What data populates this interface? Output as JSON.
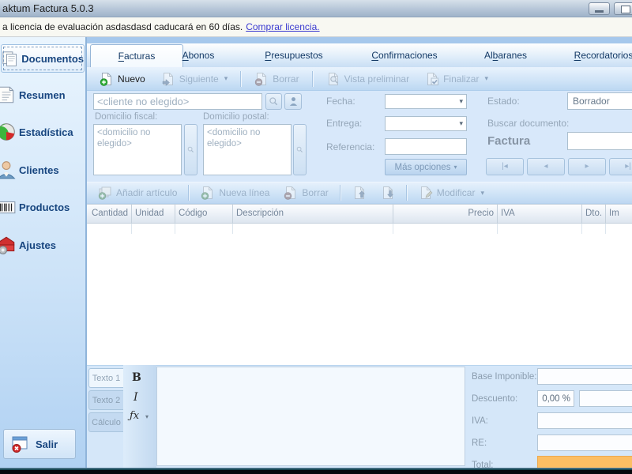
{
  "window": {
    "title": "aktum Factura 5.0.3"
  },
  "license_bar": {
    "text": "a licencia de evaluación asdasdasd caducará en 60 días.",
    "link": "Comprar licencia."
  },
  "sidebar": {
    "items": [
      {
        "label": "Documentos",
        "icon": "documents-icon",
        "active": true
      },
      {
        "label": "Resumen",
        "icon": "summary-icon",
        "active": false
      },
      {
        "label": "Estadística",
        "icon": "statistics-pie-icon",
        "active": false
      },
      {
        "label": "Clientes",
        "icon": "clients-person-icon",
        "active": false
      },
      {
        "label": "Productos",
        "icon": "products-barcode-icon",
        "active": false
      },
      {
        "label": "Ajustes",
        "icon": "settings-toolbox-icon",
        "active": false
      }
    ],
    "exit_label": "Salir"
  },
  "tabs": {
    "items": [
      {
        "label": "Facturas",
        "accel": "0",
        "active": true
      },
      {
        "label": "Abonos",
        "accel": "0",
        "active": false
      },
      {
        "label": "Presupuestos",
        "accel": "0",
        "active": false
      },
      {
        "label": "Confirmaciones",
        "accel": "0",
        "active": false
      },
      {
        "label": "Albaranes",
        "accel": "2",
        "active": false
      },
      {
        "label": "Recordatorios",
        "accel": "0",
        "active": false
      }
    ]
  },
  "doc_toolbar": {
    "new": "Nuevo",
    "next": "Siguiente",
    "delete": "Borrar",
    "preview": "Vista preliminar",
    "finalize": "Finalizar"
  },
  "form": {
    "client_placeholder": "<cliente no elegido>",
    "fiscal_address_label": "Domicilio fiscal:",
    "postal_address_label": "Domicilio postal:",
    "address_placeholder": "<domicilio no elegido>",
    "date_label": "Fecha:",
    "delivery_label": "Entrega:",
    "reference_label": "Referencia:",
    "more_options_label": "Más opciones",
    "state_label": "Estado:",
    "state_value": "Borrador",
    "search_label": "Buscar documento:",
    "doc_type_label": "Factura"
  },
  "nav": {
    "first": "|◂",
    "prev": "◂",
    "next": "▸",
    "last": "▸|"
  },
  "lines_toolbar": {
    "add_article": "Añadir artículo",
    "new_line": "Nueva línea",
    "delete": "Borrar",
    "modify": "Modificar"
  },
  "grid": {
    "columns": [
      "Cantidad",
      "Unidad",
      "Código",
      "Descripción",
      "Precio",
      "IVA",
      "Dto.",
      "Im"
    ]
  },
  "editor": {
    "tabs": [
      "Texto 1",
      "Texto 2",
      "Cálculo"
    ],
    "bold": "B",
    "italic": "I",
    "formula": "ƒx"
  },
  "totals": {
    "base_label": "Base Imponible:",
    "discount_label": "Descuento:",
    "discount_pct": "0,00 %",
    "iva_label": "IVA:",
    "re_label": "RE:",
    "total_label": "Total:"
  },
  "icons": {
    "chevron_down": "▾"
  },
  "colors": {
    "sidebar_text": "#17457f",
    "link": "#3a3ad0",
    "total_highlight": "#fbbd62",
    "new_green": "#2fae3d",
    "delete_red": "#d23b3b"
  }
}
